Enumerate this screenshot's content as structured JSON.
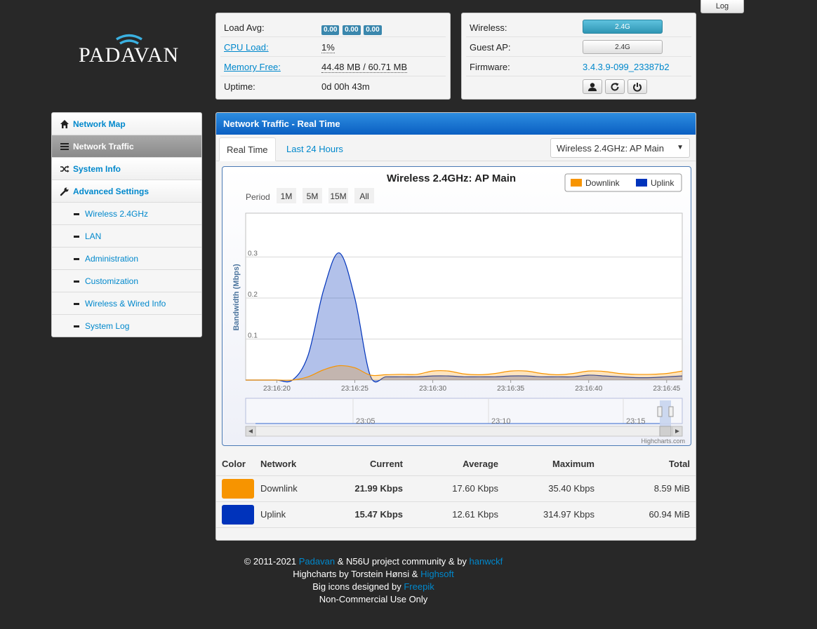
{
  "header": {
    "log_button": "Log",
    "logo_text": "PADAVAN"
  },
  "status_left": {
    "load_avg": {
      "label": "Load Avg:",
      "values": [
        "0.00",
        "0.00",
        "0.00"
      ]
    },
    "cpu_load": {
      "label": "CPU Load:",
      "value": "1%"
    },
    "memory_free": {
      "label": "Memory Free:",
      "value": "44.48 MB / 60.71 MB"
    },
    "uptime": {
      "label": "Uptime:",
      "value": "0d 00h 43m"
    }
  },
  "status_right": {
    "wireless": {
      "label": "Wireless:",
      "button": "2.4G"
    },
    "guest_ap": {
      "label": "Guest AP:",
      "button": "2.4G"
    },
    "firmware": {
      "label": "Firmware:",
      "value": "3.4.3.9-099_23387b2"
    },
    "icons": [
      "user-icon",
      "refresh-icon",
      "power-icon"
    ]
  },
  "sidebar": {
    "items": [
      {
        "label": "Network Map",
        "icon": "home-icon"
      },
      {
        "label": "Network Traffic",
        "icon": "list-icon",
        "active": true
      },
      {
        "label": "System Info",
        "icon": "shuffle-icon"
      },
      {
        "label": "Advanced Settings",
        "icon": "wrench-icon"
      }
    ],
    "sub_items": [
      "Wireless 2.4GHz",
      "LAN",
      "Administration",
      "Customization",
      "Wireless & Wired Info",
      "System Log"
    ]
  },
  "main": {
    "title": "Network Traffic - Real Time",
    "tabs": [
      "Real Time",
      "Last 24 Hours"
    ],
    "interface_select": "Wireless 2.4GHz: AP Main"
  },
  "chart_data": {
    "type": "area",
    "title": "Wireless 2.4GHz: AP Main",
    "ylabel": "Bandwidth (Mbps)",
    "xlabel": "",
    "ylim": [
      0,
      0.4
    ],
    "yticks": [
      "0.1",
      "0.2",
      "0.3"
    ],
    "x_tick_labels": [
      "23:16:20",
      "23:16:25",
      "23:16:30",
      "23:16:35",
      "23:16:40",
      "23:16:45"
    ],
    "legend": [
      "Downlink",
      "Uplink"
    ],
    "legend_position": "top-right",
    "period_label": "Period",
    "period_buttons": [
      "1M",
      "5M",
      "15M",
      "All"
    ],
    "navigator_labels": [
      "23:05",
      "23:10",
      "23:15"
    ],
    "credit": "Highcharts.com",
    "colors": {
      "Downlink": "#f79400",
      "Uplink": "#0033bb"
    },
    "x": [
      "23:16:18",
      "23:16:19",
      "23:16:20",
      "23:16:21",
      "23:16:22",
      "23:16:23",
      "23:16:24",
      "23:16:25",
      "23:16:26",
      "23:16:27",
      "23:16:28",
      "23:16:29",
      "23:16:30",
      "23:16:31",
      "23:16:32",
      "23:16:33",
      "23:16:34",
      "23:16:35",
      "23:16:36",
      "23:16:37",
      "23:16:38",
      "23:16:39",
      "23:16:40",
      "23:16:41",
      "23:16:42",
      "23:16:43",
      "23:16:44",
      "23:16:45",
      "23:16:46"
    ],
    "series": [
      {
        "name": "Downlink",
        "values": [
          0,
          0,
          0,
          0,
          0.008,
          0.025,
          0.035,
          0.03,
          0.012,
          0.013,
          0.014,
          0.014,
          0.022,
          0.022,
          0.015,
          0.013,
          0.016,
          0.022,
          0.022,
          0.016,
          0.013,
          0.016,
          0.022,
          0.021,
          0.016,
          0.014,
          0.014,
          0.016,
          0.022
        ]
      },
      {
        "name": "Uplink",
        "values": [
          0,
          0,
          0,
          0,
          0.06,
          0.22,
          0.31,
          0.2,
          0.01,
          0.008,
          0.008,
          0.008,
          0.01,
          0.01,
          0.008,
          0.008,
          0.008,
          0.01,
          0.01,
          0.008,
          0.008,
          0.008,
          0.012,
          0.01,
          0.008,
          0.006,
          0.006,
          0.008,
          0.01
        ]
      }
    ]
  },
  "traffic_table": {
    "headers": [
      "Color",
      "Network",
      "Current",
      "Average",
      "Maximum",
      "Total"
    ],
    "rows": [
      {
        "color": "#f79400",
        "network": "Downlink",
        "current": "21.99 Kbps",
        "average": "17.60 Kbps",
        "maximum": "35.40 Kbps",
        "total": "8.59 MiB"
      },
      {
        "color": "#0033bb",
        "network": "Uplink",
        "current": "15.47 Kbps",
        "average": "12.61 Kbps",
        "maximum": "314.97 Kbps",
        "total": "60.94 MiB"
      }
    ]
  },
  "footer": {
    "line1_pre": "© 2011-2021 ",
    "line1_link1": "Padavan",
    "line1_mid": " & N56U project community & by ",
    "line1_link2": "hanwckf",
    "line2_pre": "Highcharts by Torstein Hønsi & ",
    "line2_link": "Highsoft",
    "line3_pre": "Big icons designed by ",
    "line3_link": "Freepik",
    "line4": "Non-Commercial Use Only"
  }
}
